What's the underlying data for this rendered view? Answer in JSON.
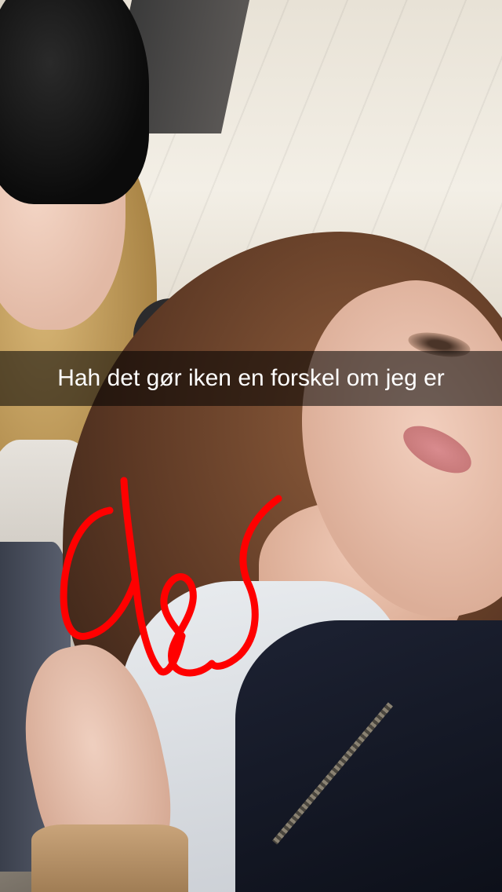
{
  "caption": {
    "text": "Hah det gør iken en forskel om jeg er"
  },
  "drawing": {
    "color": "#ff0000",
    "icon": "handwritten-scribble"
  }
}
